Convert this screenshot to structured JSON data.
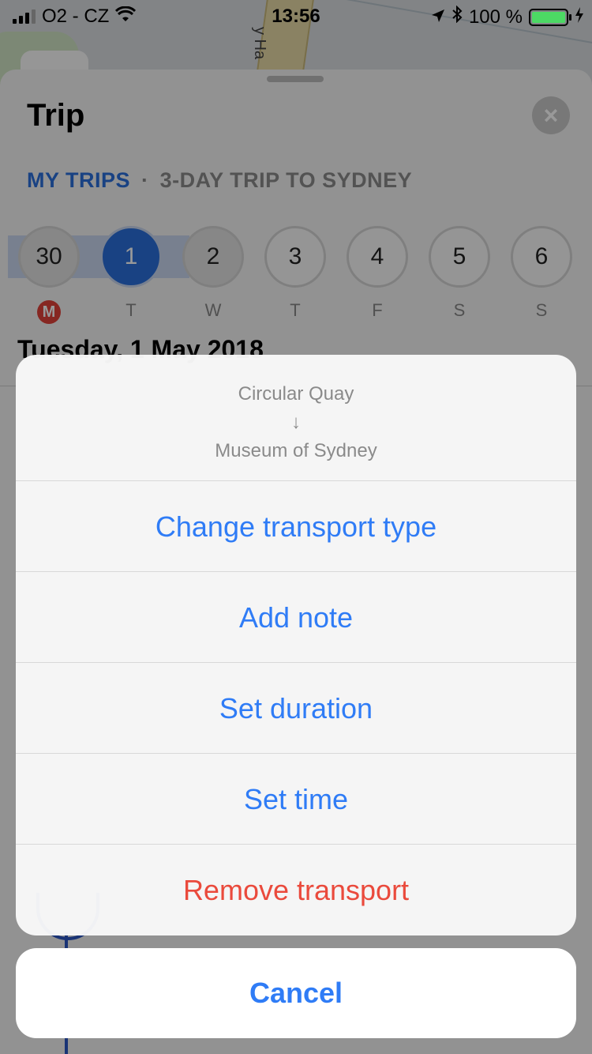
{
  "status_bar": {
    "carrier": "O2 - CZ",
    "time": "13:56",
    "battery_percent": "100 %",
    "battery_level": 1.0
  },
  "map": {
    "road_label": "y Ha"
  },
  "sheet": {
    "title": "Trip",
    "close_icon": "×",
    "breadcrumb": {
      "root": "MY TRIPS",
      "separator": "·",
      "current": "3-DAY TRIP TO SYDNEY"
    },
    "days": [
      {
        "num": "30",
        "dow": "M",
        "state": "past"
      },
      {
        "num": "1",
        "dow": "T",
        "state": "selected"
      },
      {
        "num": "2",
        "dow": "W",
        "state": "normal"
      },
      {
        "num": "3",
        "dow": "T",
        "state": "normal"
      },
      {
        "num": "4",
        "dow": "F",
        "state": "normal"
      },
      {
        "num": "5",
        "dow": "S",
        "state": "normal"
      },
      {
        "num": "6",
        "dow": "S",
        "state": "normal"
      }
    ],
    "date_heading": "Tuesday, 1 May 2018"
  },
  "action_sheet": {
    "from": "Circular Quay",
    "arrow": "↓",
    "to": "Museum of Sydney",
    "actions": [
      {
        "label": "Change transport type",
        "style": "default"
      },
      {
        "label": "Add note",
        "style": "default"
      },
      {
        "label": "Set duration",
        "style": "default"
      },
      {
        "label": "Set time",
        "style": "default"
      },
      {
        "label": "Remove transport",
        "style": "destructive"
      }
    ],
    "cancel_label": "Cancel"
  },
  "colors": {
    "accent": "#2f7cf6",
    "destructive": "#ea4a3c",
    "selected_day": "#2a6fdb",
    "weekend_marker": "#e0413a"
  }
}
